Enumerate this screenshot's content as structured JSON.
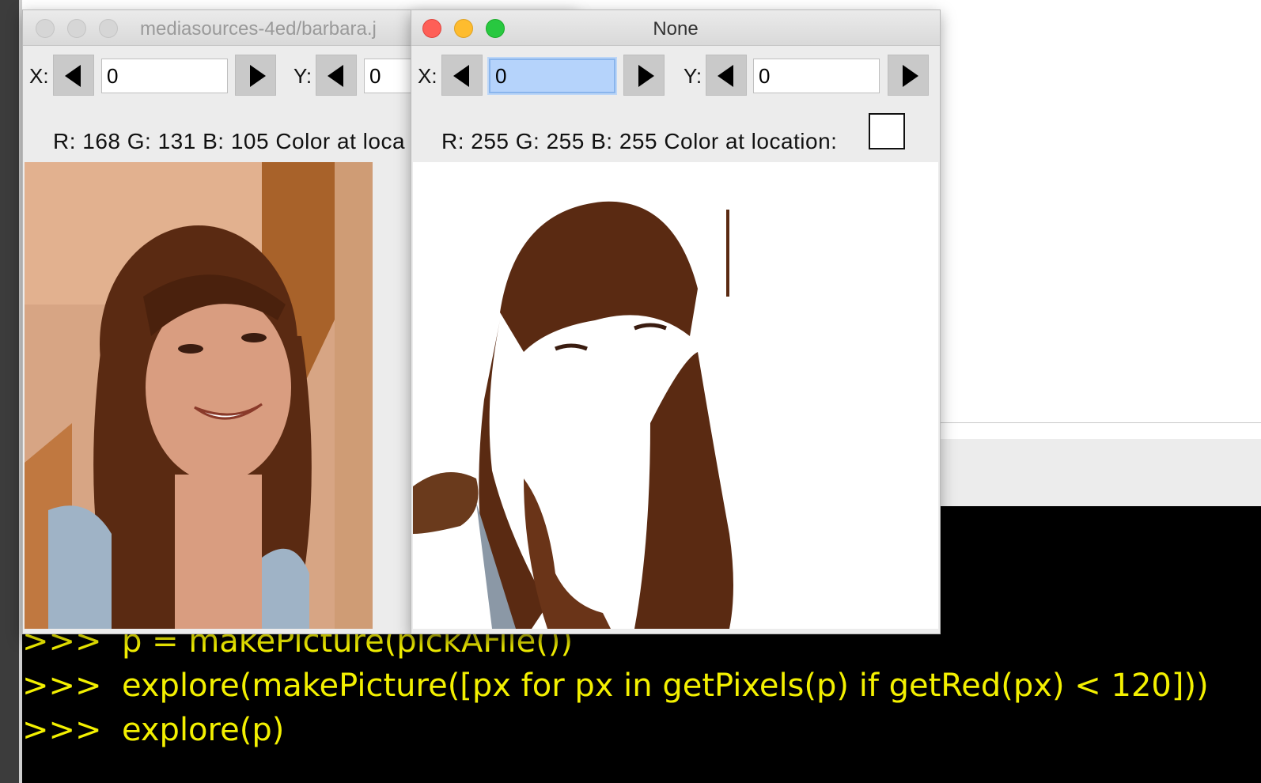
{
  "console": {
    "lines": [
      ">>>  p = makePicture(pickAFile())",
      ">>>  explore(makePicture([px for px in getPixels(p) if getRed(px) < 120]))",
      ">>>  explore(p)"
    ]
  },
  "window_back": {
    "title": "mediasources-4ed/barbara.j",
    "x_label": "X:",
    "x_value": "0",
    "y_label": "Y:",
    "y_value": "0",
    "info_text": "R: 168 G: 131 B: 105 Color at loca",
    "swatch_color": "#a88369"
  },
  "window_front": {
    "title": "None",
    "x_label": "X:",
    "x_value": "0",
    "y_label": "Y:",
    "y_value": "0",
    "info_text": "R: 255 G: 255 B: 255 Color at location:",
    "swatch_color": "#ffffff"
  },
  "colors": {
    "console_text": "#f3f000",
    "close": "#fe5f57",
    "minimize": "#febc2e",
    "zoom": "#28c840",
    "inactive_light": "#d6d6d6",
    "hair": "#5a2a12"
  }
}
